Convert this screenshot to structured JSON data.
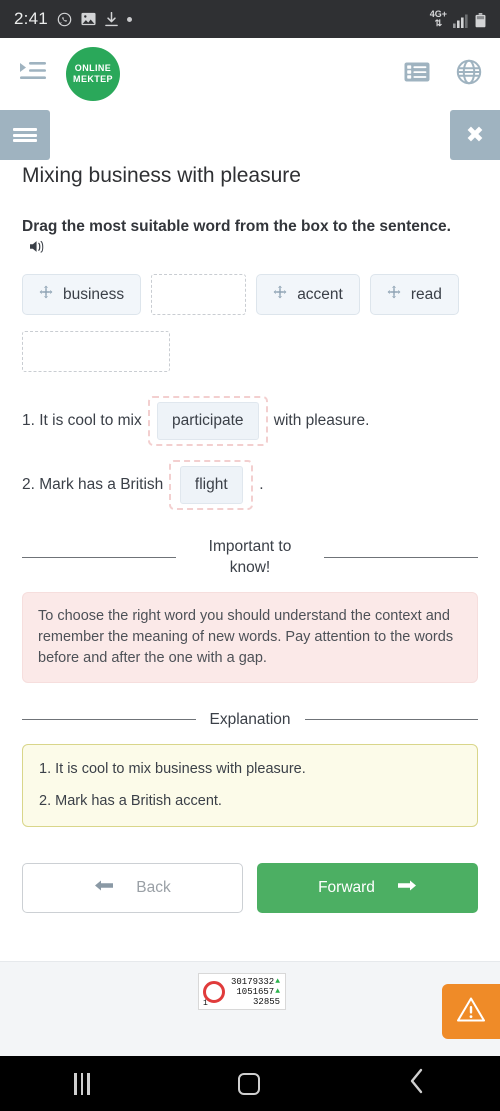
{
  "statusbar": {
    "time": "2:41",
    "icons": [
      "whatsapp-icon",
      "gallery-icon",
      "download-icon",
      "dot-icon"
    ],
    "network_label": "4G+",
    "network_sub": "⇅",
    "signal": "signal-bars-icon",
    "battery": "battery-icon"
  },
  "header": {
    "menu_icon": "indent-list-icon",
    "logo_line1": "ONLINE",
    "logo_line2": "MEKTEP",
    "list_icon": "list-view-icon",
    "globe_icon": "globe-icon"
  },
  "toolbar": {
    "menu_label": "hamburger-menu",
    "close_label": "✖"
  },
  "main": {
    "title": "Mixing business with pleasure",
    "instruction": "Drag the most suitable word from the box to the sentence.",
    "audio_icon": "speaker-icon",
    "wordbank": [
      {
        "type": "chip",
        "label": "business"
      },
      {
        "type": "empty"
      },
      {
        "type": "chip",
        "label": "accent"
      },
      {
        "type": "chip",
        "label": "read"
      },
      {
        "type": "empty"
      }
    ],
    "sentences": [
      {
        "number": "1.",
        "before": "It is cool to mix",
        "answer": "participate",
        "after": "with pleasure.",
        "state": "incorrect"
      },
      {
        "number": "2.",
        "before": "Mark has a British",
        "answer": "flight",
        "after": ".",
        "state": "incorrect"
      }
    ],
    "note": {
      "heading": "Important to know!",
      "text": "To choose the right word you should understand the context and remember the meaning of new words. Pay attention to the words before and after the one with a gap."
    },
    "explanation": {
      "heading": "Explanation",
      "lines": [
        "1. It is cool to mix business with pleasure.",
        "2. Mark has a British accent."
      ]
    },
    "nav": {
      "back_label": "Back",
      "back_icon": "arrow-left-icon",
      "forward_label": "Forward",
      "forward_icon": "arrow-right-icon"
    }
  },
  "footer": {
    "counter": {
      "index": "1",
      "value1": "30179332",
      "value2": "1051657",
      "value3": "32855",
      "trend_icon": "triangle-up-icon"
    },
    "warning_icon": "warning-triangle-icon"
  },
  "navbar": {
    "recents": "recents-icon",
    "home": "home-icon",
    "back": "back-chevron-icon"
  },
  "colors": {
    "brand_green": "#2aa85a",
    "forward_green": "#4caf63",
    "toolbar_blue": "#9fb3c0",
    "note_pink": "#fbe9e8",
    "explanation_yellow": "#fcfbe9",
    "warning_orange": "#ef8b28",
    "error_border": "#f3cfcf"
  }
}
